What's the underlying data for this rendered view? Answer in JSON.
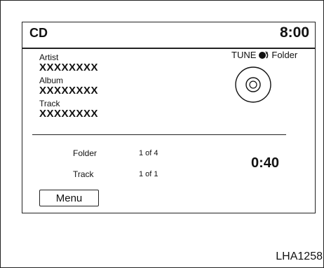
{
  "header": {
    "source": "CD",
    "clock": "8:00"
  },
  "track_info": {
    "artist_label": "Artist",
    "artist_value": "XXXXXXXX",
    "album_label": "Album",
    "album_value": "XXXXXXXX",
    "track_label": "Track",
    "track_value": "XXXXXXXX"
  },
  "tune": {
    "label": "TUNE",
    "action": "Folder",
    "knob_icon": "tune-knob-icon"
  },
  "disc": {
    "icon": "cd-disc-icon"
  },
  "playback": {
    "folder_label": "Folder",
    "folder_value": "1 of 4",
    "track_label": "Track",
    "track_value": "1 of 1",
    "elapsed_time": "0:40"
  },
  "menu": {
    "label": "Menu"
  },
  "figure_code": "LHA1258"
}
